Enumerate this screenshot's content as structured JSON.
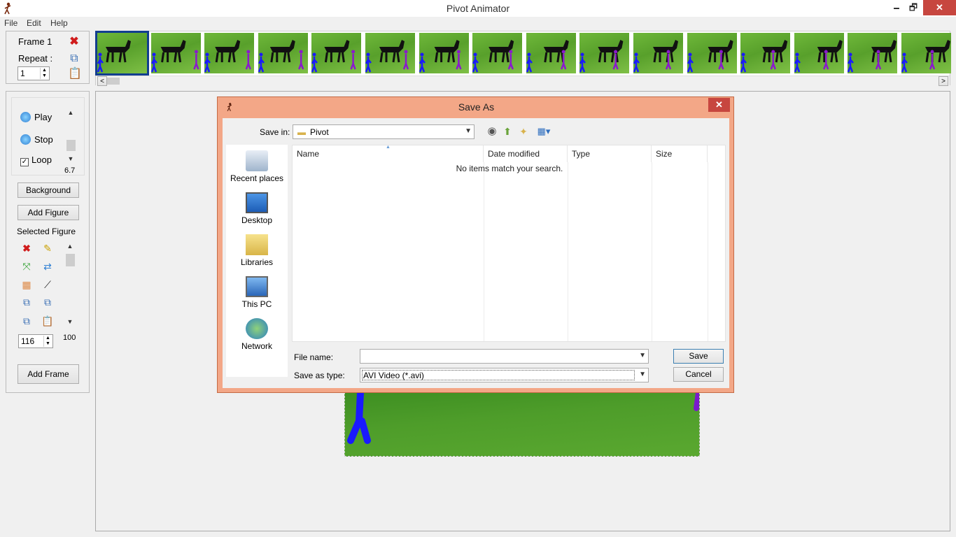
{
  "window": {
    "title": "Pivot Animator",
    "controls": {
      "minimize": "🗕",
      "maximize": "🗗",
      "close": "✕"
    }
  },
  "menu": {
    "items": [
      "File",
      "Edit",
      "Help"
    ]
  },
  "frame_panel": {
    "frame_label": "Frame 1",
    "repeat_label": "Repeat :",
    "repeat_value": "1"
  },
  "thumbnails": {
    "count": 16,
    "selected_index": 0
  },
  "playback": {
    "play_label": "Play",
    "stop_label": "Stop",
    "loop_label": "Loop",
    "loop_checked": true,
    "speed_value": "6.7"
  },
  "buttons": {
    "background": "Background",
    "add_figure": "Add Figure",
    "add_frame": "Add Frame"
  },
  "selected_figure": {
    "label": "Selected Figure",
    "size_value": "116",
    "opacity_value": "100"
  },
  "dialog": {
    "title": "Save As",
    "save_in_label": "Save in:",
    "save_in_value": "Pivot",
    "places": [
      "Recent places",
      "Desktop",
      "Libraries",
      "This PC",
      "Network"
    ],
    "columns": [
      "Name",
      "Date modified",
      "Type",
      "Size"
    ],
    "empty_message": "No items match your search.",
    "file_name_label": "File name:",
    "file_name_value": "",
    "save_type_label": "Save as type:",
    "save_type_value": "AVI Video (*.avi)",
    "save_button": "Save",
    "cancel_button": "Cancel"
  },
  "colors": {
    "accent": "#123e8f",
    "dialog_frame": "#f3a787",
    "close_red": "#c7463f",
    "grass": "#58a02b"
  }
}
